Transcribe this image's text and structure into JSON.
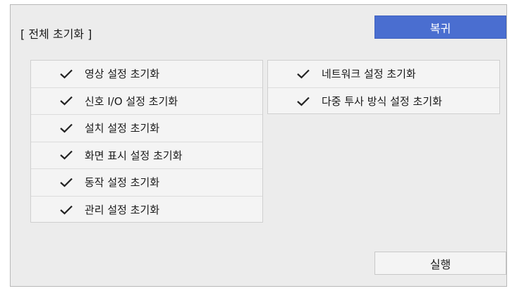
{
  "dialog": {
    "title": "[ 전체 초기화 ]",
    "restore_button": "복귀",
    "execute_button": "실행"
  },
  "left_items": [
    {
      "label": "영상 설정 초기화",
      "icon": "check-icon"
    },
    {
      "label": "신호 I/O 설정 초기화",
      "icon": "check-icon"
    },
    {
      "label": "설치 설정 초기화",
      "icon": "check-icon"
    },
    {
      "label": "화면 표시 설정 초기화",
      "icon": "check-icon"
    },
    {
      "label": "동작 설정 초기화",
      "icon": "check-icon"
    },
    {
      "label": "관리 설정 초기화",
      "icon": "check-icon"
    }
  ],
  "right_items": [
    {
      "label": "네트워크 설정 초기화",
      "icon": "check-icon"
    },
    {
      "label": "다중 투사 방식 설정 초기화",
      "icon": "check-icon"
    }
  ],
  "colors": {
    "accent": "#4a6ed0",
    "panel_background": "#ececec"
  }
}
